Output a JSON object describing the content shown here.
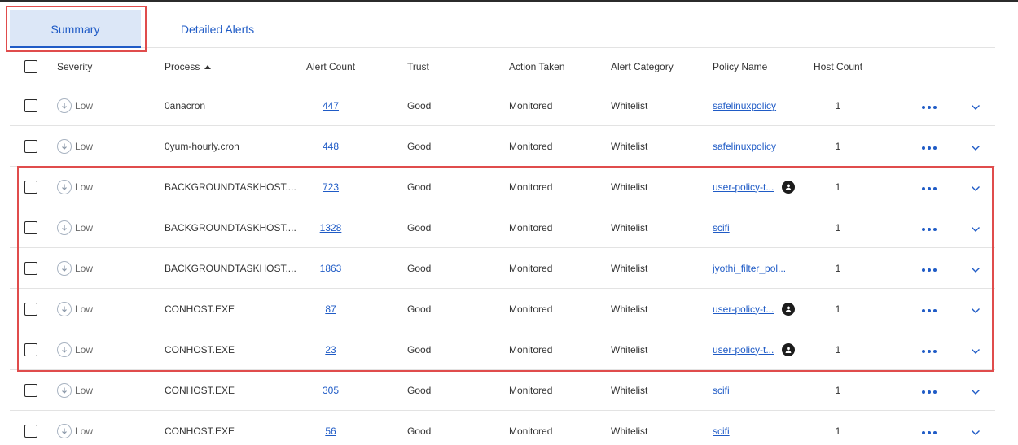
{
  "tabs": [
    {
      "label": "Summary",
      "active": true
    },
    {
      "label": "Detailed Alerts",
      "active": false
    }
  ],
  "columns": {
    "severity": "Severity",
    "process": "Process",
    "alert_count": "Alert Count",
    "trust": "Trust",
    "action_taken": "Action Taken",
    "alert_category": "Alert Category",
    "policy_name": "Policy Name",
    "host_count": "Host Count"
  },
  "sort": {
    "column": "Process",
    "direction": "ascending"
  },
  "rows": [
    {
      "severity": "Low",
      "process": "0anacron",
      "alert_count": "447",
      "trust": "Good",
      "action_taken": "Monitored",
      "alert_category": "Whitelist",
      "policy_name": "safelinuxpolicy",
      "user_policy": false,
      "host_count": "1"
    },
    {
      "severity": "Low",
      "process": "0yum-hourly.cron",
      "alert_count": "448",
      "trust": "Good",
      "action_taken": "Monitored",
      "alert_category": "Whitelist",
      "policy_name": "safelinuxpolicy",
      "user_policy": false,
      "host_count": "1"
    },
    {
      "severity": "Low",
      "process": "BACKGROUNDTASKHOST....",
      "alert_count": "723",
      "trust": "Good",
      "action_taken": "Monitored",
      "alert_category": "Whitelist",
      "policy_name": "user-policy-t...",
      "user_policy": true,
      "host_count": "1"
    },
    {
      "severity": "Low",
      "process": "BACKGROUNDTASKHOST....",
      "alert_count": "1328",
      "trust": "Good",
      "action_taken": "Monitored",
      "alert_category": "Whitelist",
      "policy_name": "scifi",
      "user_policy": false,
      "host_count": "1"
    },
    {
      "severity": "Low",
      "process": "BACKGROUNDTASKHOST....",
      "alert_count": "1863",
      "trust": "Good",
      "action_taken": "Monitored",
      "alert_category": "Whitelist",
      "policy_name": "jyothi_filter_pol...",
      "user_policy": false,
      "host_count": "1"
    },
    {
      "severity": "Low",
      "process": "CONHOST.EXE",
      "alert_count": "87",
      "trust": "Good",
      "action_taken": "Monitored",
      "alert_category": "Whitelist",
      "policy_name": "user-policy-t...",
      "user_policy": true,
      "host_count": "1"
    },
    {
      "severity": "Low",
      "process": "CONHOST.EXE",
      "alert_count": "23",
      "trust": "Good",
      "action_taken": "Monitored",
      "alert_category": "Whitelist",
      "policy_name": "user-policy-t...",
      "user_policy": true,
      "host_count": "1"
    },
    {
      "severity": "Low",
      "process": "CONHOST.EXE",
      "alert_count": "305",
      "trust": "Good",
      "action_taken": "Monitored",
      "alert_category": "Whitelist",
      "policy_name": "scifi",
      "user_policy": false,
      "host_count": "1"
    },
    {
      "severity": "Low",
      "process": "CONHOST.EXE",
      "alert_count": "56",
      "trust": "Good",
      "action_taken": "Monitored",
      "alert_category": "Whitelist",
      "policy_name": "scifi",
      "user_policy": false,
      "host_count": "1"
    }
  ],
  "icons": {
    "severity": "arrow-down-circle-icon",
    "user_policy": "user-icon",
    "row_menu": "more-horizontal-icon",
    "row_expand": "chevron-down-icon",
    "sort": "sort-up-icon"
  },
  "colors": {
    "accent": "#1f5bc6",
    "active_tab_bg": "#dce7f7",
    "highlight": "#e04c4c"
  }
}
